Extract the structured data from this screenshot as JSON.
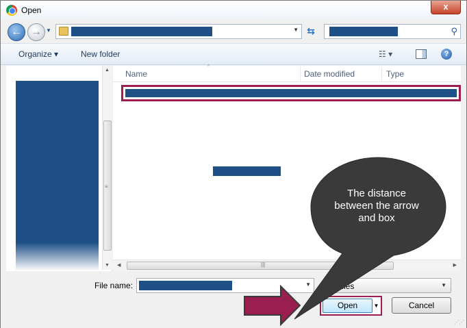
{
  "window": {
    "title": "Open",
    "close_label": "x"
  },
  "nav": {
    "back_glyph": "←",
    "forward_glyph": "→",
    "dropdown_glyph": "▼",
    "refresh_glyph": "⇆",
    "search_glyph": "⚲"
  },
  "toolbar": {
    "organize_label": "Organize ▾",
    "new_folder_label": "New folder",
    "view_label": "☷ ▾",
    "help_label": "?"
  },
  "file_list": {
    "columns": [
      "Name",
      "Date modified",
      "Type"
    ],
    "sort_glyph": "^"
  },
  "scrollbar": {
    "up": "▲",
    "down": "▼",
    "left": "◀",
    "right": "▶",
    "grip": "≡",
    "hgrip": "|||"
  },
  "bottom": {
    "file_name_label": "File name:",
    "filter_value": "Files",
    "open_label": "Open",
    "cancel_label": "Cancel",
    "split_glyph": "▼"
  },
  "annotation": {
    "callout_text": "The distance between the arrow and box",
    "callout_color": "#3a3a3a",
    "arrow_color": "#9b1e50",
    "highlight_color": "#9b1e50"
  },
  "redaction_color": "#1f4f87"
}
